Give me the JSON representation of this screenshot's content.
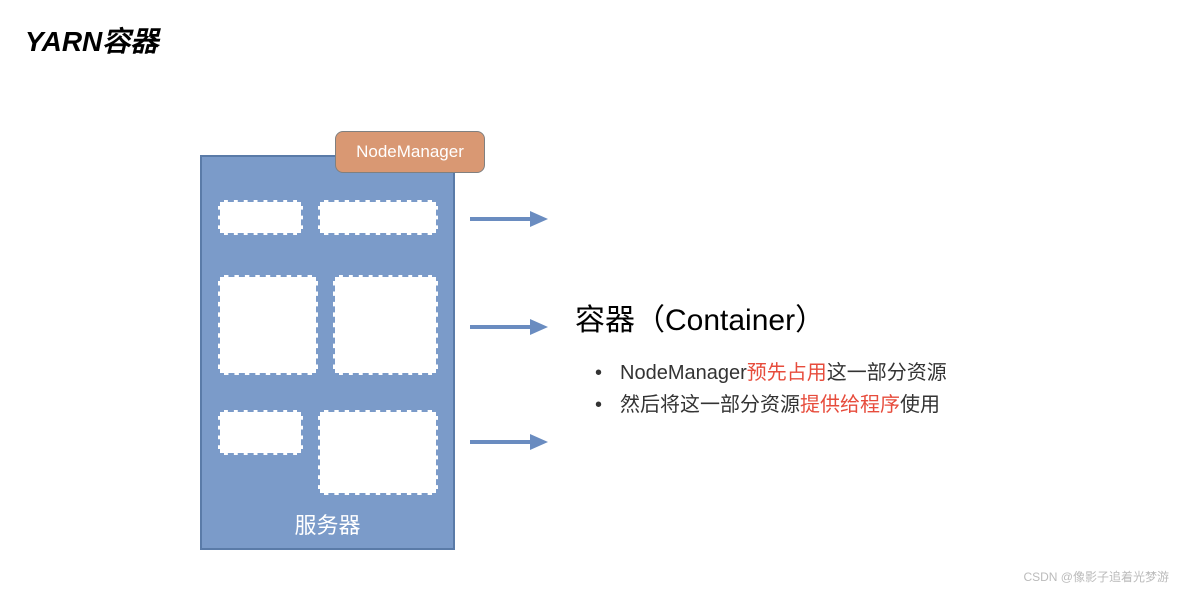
{
  "title": "YARN容器",
  "nodemanager_label": "NodeManager",
  "server_label": "服务器",
  "right": {
    "heading": "容器（Container）",
    "bullet1_prefix": "NodeManager",
    "bullet1_red": "预先占用",
    "bullet1_suffix": "这一部分资源",
    "bullet2_prefix": "然后将这一部分资源",
    "bullet2_red": "提供给程序",
    "bullet2_suffix": "使用"
  },
  "watermark": "CSDN @像影子追着光梦游"
}
